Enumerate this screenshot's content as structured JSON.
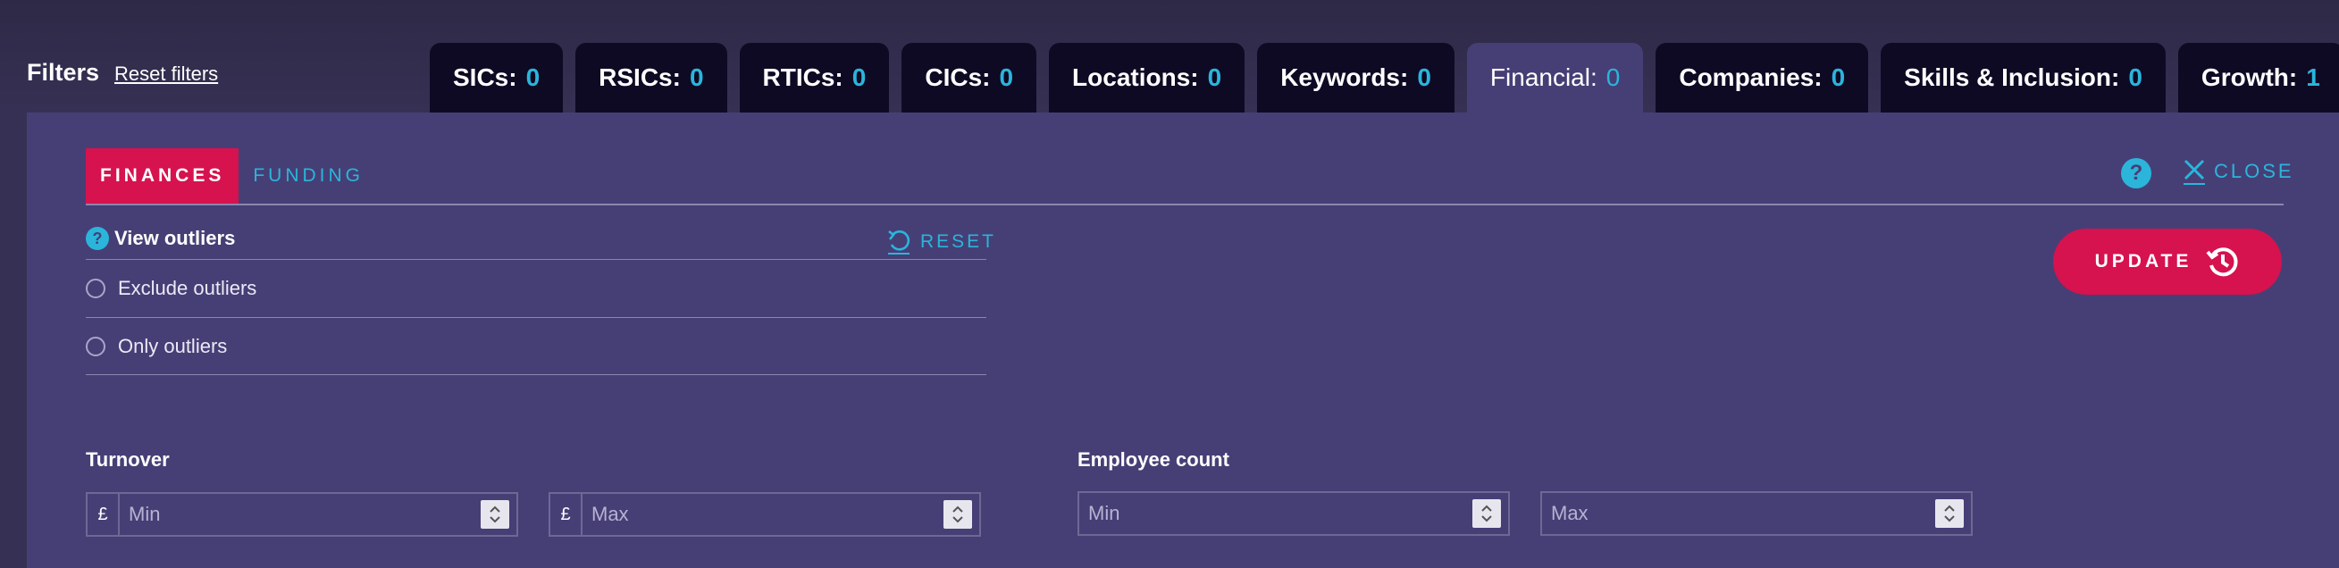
{
  "header": {
    "title": "Filters",
    "reset_filters": "Reset filters"
  },
  "tabs": [
    {
      "label": "SICs:",
      "count": "0"
    },
    {
      "label": "RSICs:",
      "count": "0"
    },
    {
      "label": "RTICs:",
      "count": "0"
    },
    {
      "label": "CICs:",
      "count": "0"
    },
    {
      "label": "Locations:",
      "count": "0"
    },
    {
      "label": "Keywords:",
      "count": "0"
    },
    {
      "label": "Financial:",
      "count": "0",
      "active": true
    },
    {
      "label": "Companies:",
      "count": "0"
    },
    {
      "label": "Skills & Inclusion:",
      "count": "0"
    },
    {
      "label": "Growth:",
      "count": "1"
    }
  ],
  "panel": {
    "subtabs": [
      {
        "label": "FINANCES",
        "active": true
      },
      {
        "label": "FUNDING",
        "active": false
      }
    ],
    "help_icon": "?",
    "close_label": "CLOSE",
    "outliers": {
      "help_icon": "?",
      "title": "View outliers",
      "reset_label": "RESET",
      "options": [
        "Exclude outliers",
        "Only outliers"
      ]
    },
    "update_label": "UPDATE",
    "turnover": {
      "label": "Turnover",
      "currency_symbol": "£",
      "min_placeholder": "Min",
      "max_placeholder": "Max"
    },
    "employee_count": {
      "label": "Employee count",
      "min_placeholder": "Min",
      "max_placeholder": "Max"
    }
  },
  "colors": {
    "accent_pink": "#d6124f",
    "accent_cyan": "#2bb5db",
    "panel_bg": "#463f76",
    "tab_bg": "#0e0a24"
  }
}
